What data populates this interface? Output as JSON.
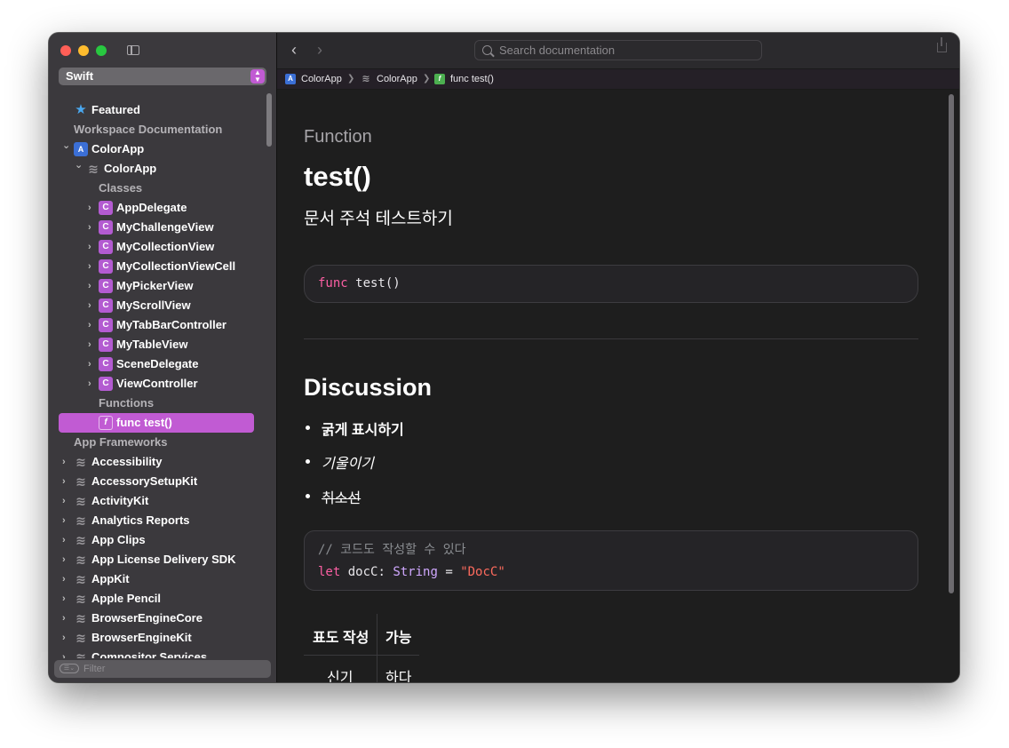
{
  "sidebar": {
    "language": "Swift",
    "filter_placeholder": "Filter",
    "tree": [
      {
        "label": "Featured",
        "kind": "featured",
        "icon": "star-icon"
      },
      {
        "label": "Workspace Documentation",
        "kind": "section"
      },
      {
        "label": "ColorApp",
        "kind": "app",
        "icon": "app-icon",
        "expanded": true
      },
      {
        "label": "ColorApp",
        "kind": "module",
        "icon": "module-icon",
        "expanded": true
      },
      {
        "label": "Classes",
        "kind": "section"
      },
      {
        "label": "AppDelegate",
        "kind": "class",
        "icon": "class-icon"
      },
      {
        "label": "MyChallengeView",
        "kind": "class",
        "icon": "class-icon"
      },
      {
        "label": "MyCollectionView",
        "kind": "class",
        "icon": "class-icon"
      },
      {
        "label": "MyCollectionViewCell",
        "kind": "class",
        "icon": "class-icon"
      },
      {
        "label": "MyPickerView",
        "kind": "class",
        "icon": "class-icon"
      },
      {
        "label": "MyScrollView",
        "kind": "class",
        "icon": "class-icon"
      },
      {
        "label": "MyTabBarController",
        "kind": "class",
        "icon": "class-icon"
      },
      {
        "label": "MyTableView",
        "kind": "class",
        "icon": "class-icon"
      },
      {
        "label": "SceneDelegate",
        "kind": "class",
        "icon": "class-icon"
      },
      {
        "label": "ViewController",
        "kind": "class",
        "icon": "class-icon"
      },
      {
        "label": "Functions",
        "kind": "section"
      },
      {
        "label": "func test()",
        "kind": "function",
        "icon": "function-icon",
        "selected": true
      },
      {
        "label": "App Frameworks",
        "kind": "section"
      },
      {
        "label": "Accessibility",
        "kind": "framework",
        "icon": "framework-icon"
      },
      {
        "label": "AccessorySetupKit",
        "kind": "framework",
        "icon": "framework-icon"
      },
      {
        "label": "ActivityKit",
        "kind": "framework",
        "icon": "framework-icon"
      },
      {
        "label": "Analytics Reports",
        "kind": "framework",
        "icon": "framework-icon"
      },
      {
        "label": "App Clips",
        "kind": "framework",
        "icon": "framework-icon"
      },
      {
        "label": "App License Delivery SDK",
        "kind": "framework",
        "icon": "framework-icon"
      },
      {
        "label": "AppKit",
        "kind": "framework",
        "icon": "framework-icon"
      },
      {
        "label": "Apple Pencil",
        "kind": "framework",
        "icon": "framework-icon"
      },
      {
        "label": "BrowserEngineCore",
        "kind": "framework",
        "icon": "framework-icon"
      },
      {
        "label": "BrowserEngineKit",
        "kind": "framework",
        "icon": "framework-icon"
      },
      {
        "label": "Compositor Services",
        "kind": "framework",
        "icon": "framework-icon"
      }
    ]
  },
  "toolbar": {
    "search_placeholder": "Search documentation"
  },
  "breadcrumb": {
    "items": [
      {
        "label": "ColorApp",
        "icon": "app-icon"
      },
      {
        "label": "ColorApp",
        "icon": "module-icon"
      },
      {
        "label": "func test()",
        "icon": "function-icon"
      }
    ]
  },
  "doc": {
    "eyebrow": "Function",
    "title": "test()",
    "abstract": "문서 주석 테스트하기",
    "declaration": {
      "keyword": "func",
      "rest": " test()"
    },
    "discussion_heading": "Discussion",
    "bullets": [
      "굵게 표시하기",
      "기울이기",
      "취소선"
    ],
    "code": {
      "comment": "// 코드도 작성할 수 있다",
      "line2_kw": "let",
      "line2_name": " docC: ",
      "line2_type": "String",
      "line2_eq": " = ",
      "line2_str": "\"DocC\""
    },
    "table": {
      "headers": [
        "표도 작성",
        "가능"
      ],
      "rows": [
        [
          "신기",
          "하다"
        ]
      ]
    }
  },
  "colors": {
    "accent": "#c15bd3",
    "keyword": "#fc5fa3",
    "string": "#fc6a5d",
    "type": "#d0a8ff"
  }
}
